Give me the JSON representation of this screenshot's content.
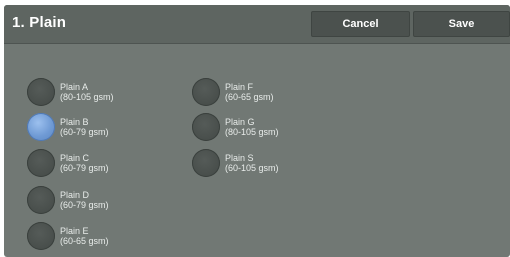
{
  "header": {
    "title": "1. Plain",
    "cancel_label": "Cancel",
    "save_label": "Save"
  },
  "options": [
    {
      "name": "Plain A",
      "weight": "(80-105 gsm)"
    },
    {
      "name": "Plain B",
      "weight": "(60-79 gsm)"
    },
    {
      "name": "Plain C",
      "weight": "(60-79 gsm)"
    },
    {
      "name": "Plain D",
      "weight": "(60-79 gsm)"
    },
    {
      "name": "Plain E",
      "weight": "(60-65 gsm)"
    },
    {
      "name": "Plain F",
      "weight": "(60-65 gsm)"
    },
    {
      "name": "Plain G",
      "weight": "(80-105 gsm)"
    },
    {
      "name": "Plain S",
      "weight": "(60-105 gsm)"
    }
  ],
  "selected_option": "Plain B",
  "colors": {
    "panel": "#717874",
    "header": "#5e6561",
    "button": "#4b514e",
    "radio_selected": "#6f9ad4"
  }
}
